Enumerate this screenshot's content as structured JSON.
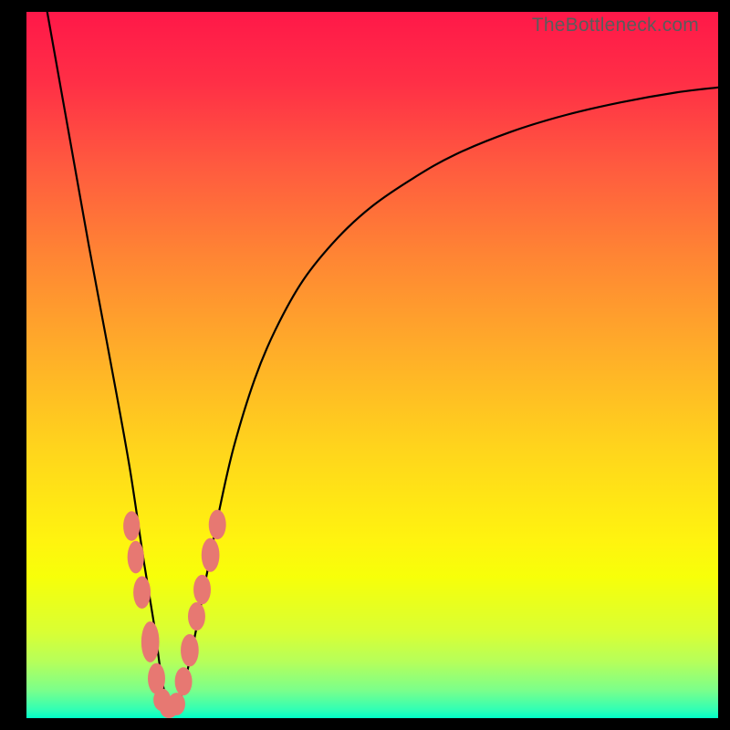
{
  "watermark": "TheBottleneck.com",
  "colors": {
    "frame": "#000000",
    "marker": "#e77872",
    "curve": "#000000"
  },
  "chart_data": {
    "type": "line",
    "title": "",
    "xlabel": "",
    "ylabel": "",
    "xlim": [
      0,
      100
    ],
    "ylim": [
      0,
      100
    ],
    "series": [
      {
        "name": "bottleneck-curve",
        "x": [
          3,
          5,
          7,
          9,
          11,
          13,
          15,
          17,
          18.5,
          19.5,
          20.5,
          22,
          24,
          26,
          28,
          30,
          33,
          36,
          40,
          45,
          50,
          56,
          62,
          70,
          78,
          86,
          94,
          100
        ],
        "values": [
          100,
          89,
          78,
          67,
          56.5,
          46,
          35,
          22,
          13,
          6,
          2,
          2,
          10,
          20,
          30,
          38.5,
          48,
          55,
          62,
          68,
          72.5,
          76.5,
          79.8,
          83,
          85.4,
          87.2,
          88.6,
          89.3
        ]
      },
      {
        "name": "markers",
        "points": [
          {
            "x": 15.2,
            "y": 27.2,
            "rx": 1.2,
            "ry": 2.1
          },
          {
            "x": 15.8,
            "y": 22.8,
            "rx": 1.2,
            "ry": 2.3
          },
          {
            "x": 16.7,
            "y": 17.8,
            "rx": 1.25,
            "ry": 2.3
          },
          {
            "x": 17.9,
            "y": 10.8,
            "rx": 1.3,
            "ry": 2.9
          },
          {
            "x": 18.8,
            "y": 5.6,
            "rx": 1.25,
            "ry": 2.2
          },
          {
            "x": 19.6,
            "y": 2.6,
            "rx": 1.25,
            "ry": 1.6
          },
          {
            "x": 20.6,
            "y": 1.3,
            "rx": 1.3,
            "ry": 1.3
          },
          {
            "x": 21.7,
            "y": 2.0,
            "rx": 1.25,
            "ry": 1.6
          },
          {
            "x": 22.7,
            "y": 5.2,
            "rx": 1.25,
            "ry": 2.0
          },
          {
            "x": 23.6,
            "y": 9.6,
            "rx": 1.3,
            "ry": 2.3
          },
          {
            "x": 24.6,
            "y": 14.4,
            "rx": 1.25,
            "ry": 2.0
          },
          {
            "x": 25.4,
            "y": 18.2,
            "rx": 1.25,
            "ry": 2.1
          },
          {
            "x": 26.6,
            "y": 23.1,
            "rx": 1.3,
            "ry": 2.4
          },
          {
            "x": 27.6,
            "y": 27.4,
            "rx": 1.25,
            "ry": 2.1
          }
        ]
      }
    ]
  }
}
